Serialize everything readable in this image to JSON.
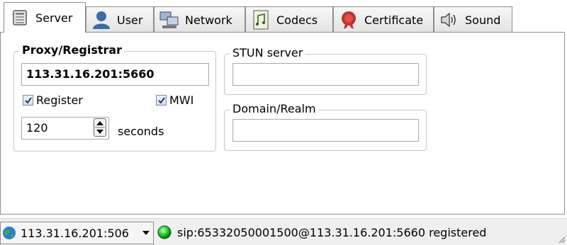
{
  "tabs": [
    {
      "label": "Server",
      "icon": "server-icon",
      "active": true
    },
    {
      "label": "User",
      "icon": "user-icon",
      "active": false
    },
    {
      "label": "Network",
      "icon": "network-icon",
      "active": false
    },
    {
      "label": "Codecs",
      "icon": "codecs-icon",
      "active": false
    },
    {
      "label": "Certificate",
      "icon": "certificate-icon",
      "active": false
    },
    {
      "label": "Sound",
      "icon": "sound-icon",
      "active": false
    }
  ],
  "proxy": {
    "title": "Proxy/Registrar",
    "address": "113.31.16.201:5660",
    "register_label": "Register",
    "register_checked": true,
    "mwi_label": "MWI",
    "mwi_checked": true,
    "expire_value": "120",
    "expire_unit": "seconds"
  },
  "stun": {
    "title": "STUN server",
    "value": ""
  },
  "domain": {
    "title": "Domain/Realm",
    "value": ""
  },
  "statusbar": {
    "account_combo": "113.31.16.201:506",
    "status_text": "sip:65332050001500@113.31.16.201:5660 registered",
    "status_color": "#22cc22"
  }
}
